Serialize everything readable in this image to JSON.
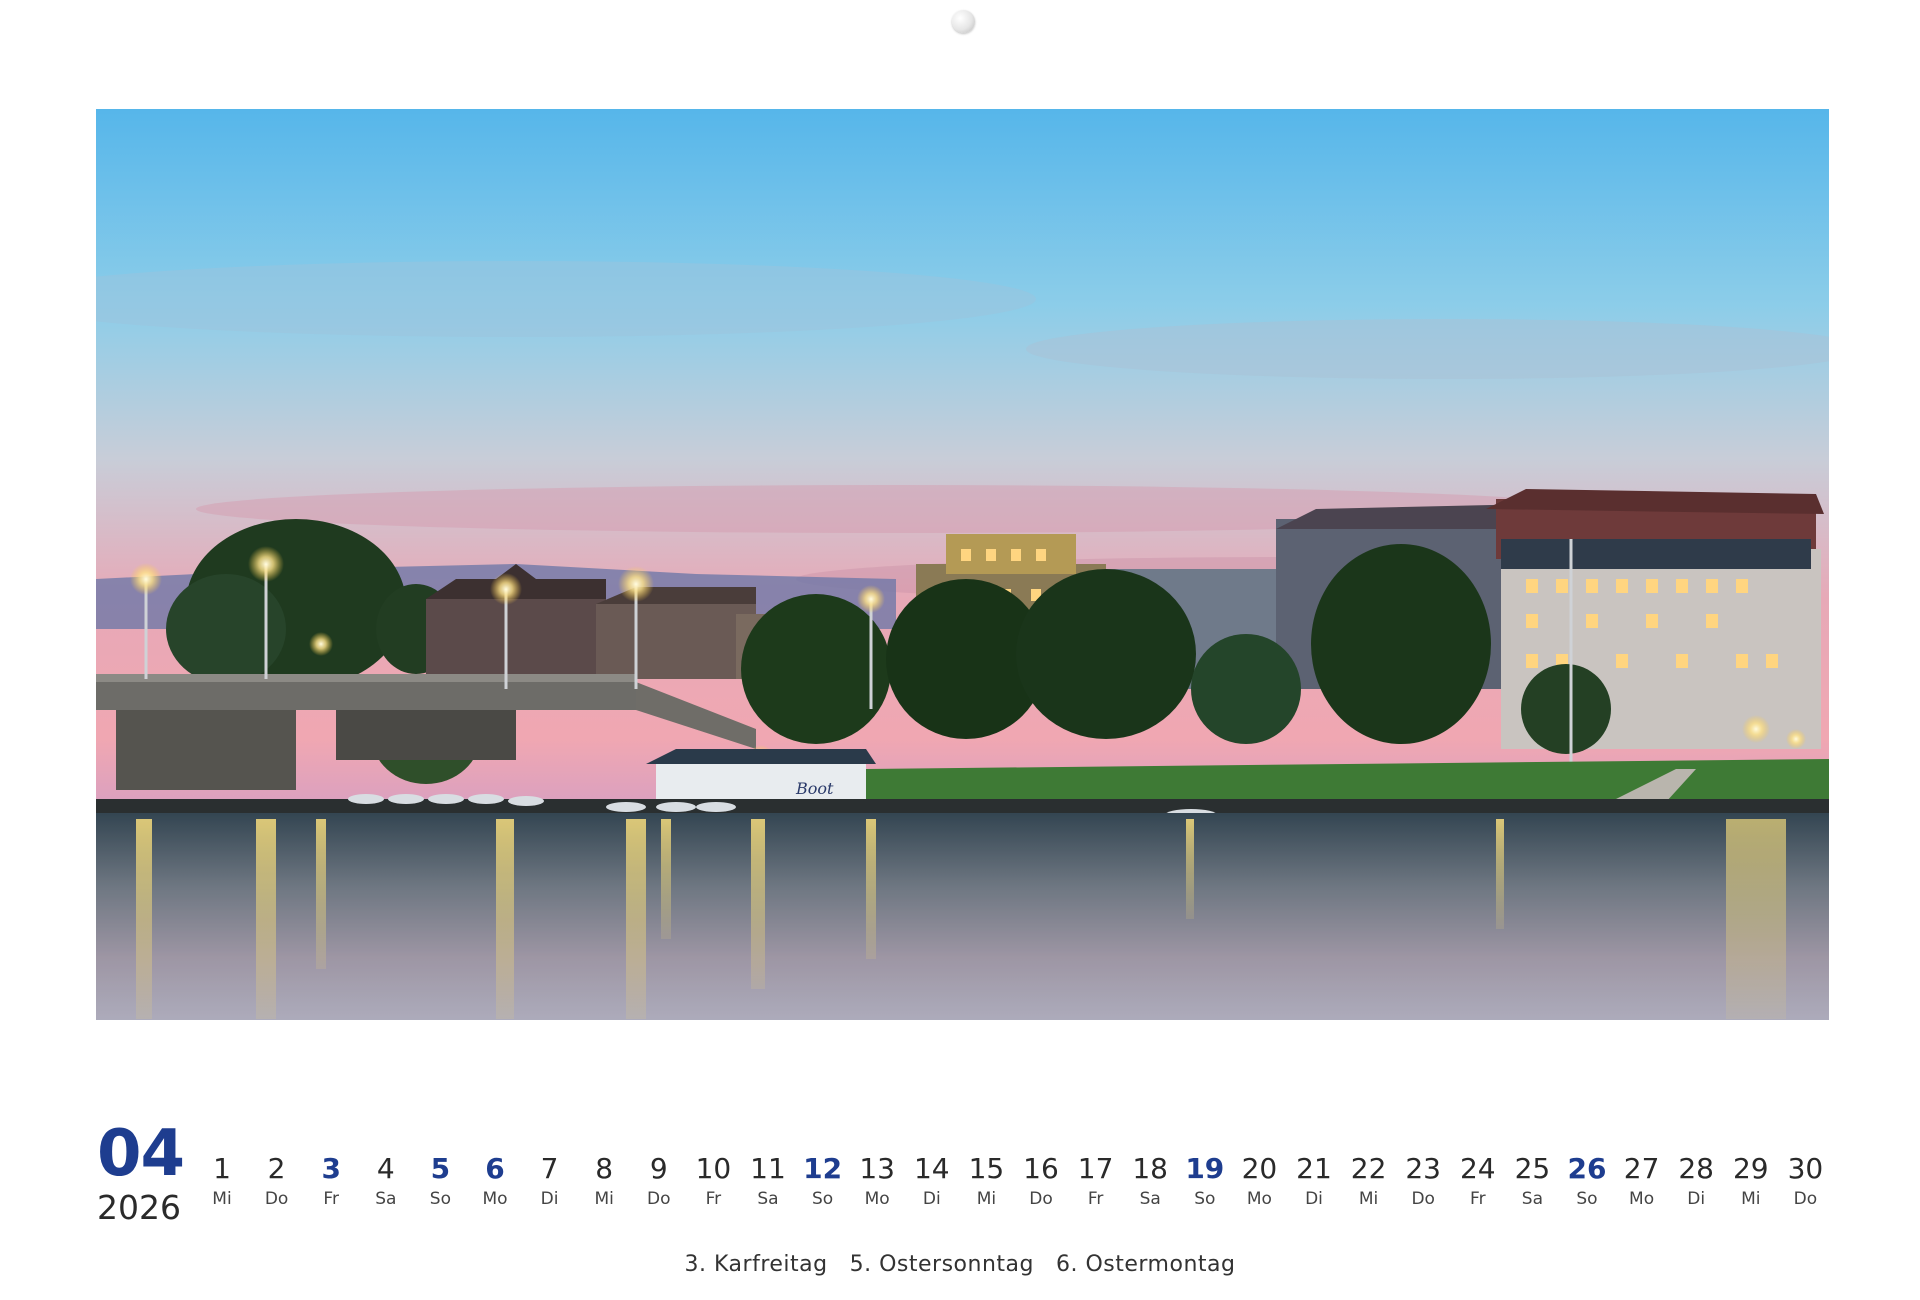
{
  "calendar": {
    "month": "04",
    "year": "2026",
    "days": [
      {
        "d": "1",
        "w": "Mi"
      },
      {
        "d": "2",
        "w": "Do"
      },
      {
        "d": "3",
        "w": "Fr",
        "highlight": true
      },
      {
        "d": "4",
        "w": "Sa"
      },
      {
        "d": "5",
        "w": "So",
        "highlight": true
      },
      {
        "d": "6",
        "w": "Mo",
        "highlight": true
      },
      {
        "d": "7",
        "w": "Di"
      },
      {
        "d": "8",
        "w": "Mi"
      },
      {
        "d": "9",
        "w": "Do"
      },
      {
        "d": "10",
        "w": "Fr"
      },
      {
        "d": "11",
        "w": "Sa"
      },
      {
        "d": "12",
        "w": "So",
        "highlight": true
      },
      {
        "d": "13",
        "w": "Mo"
      },
      {
        "d": "14",
        "w": "Di"
      },
      {
        "d": "15",
        "w": "Mi"
      },
      {
        "d": "16",
        "w": "Do"
      },
      {
        "d": "17",
        "w": "Fr"
      },
      {
        "d": "18",
        "w": "Sa"
      },
      {
        "d": "19",
        "w": "So",
        "highlight": true
      },
      {
        "d": "20",
        "w": "Mo"
      },
      {
        "d": "21",
        "w": "Di"
      },
      {
        "d": "22",
        "w": "Mi"
      },
      {
        "d": "23",
        "w": "Do"
      },
      {
        "d": "24",
        "w": "Fr"
      },
      {
        "d": "25",
        "w": "Sa"
      },
      {
        "d": "26",
        "w": "So",
        "highlight": true
      },
      {
        "d": "27",
        "w": "Mo"
      },
      {
        "d": "28",
        "w": "Di"
      },
      {
        "d": "29",
        "w": "Mi"
      },
      {
        "d": "30",
        "w": "Do"
      }
    ],
    "holidays": [
      "3. Karfreitag",
      "5. Ostersonntag",
      "6. Ostermontag"
    ]
  },
  "photo": {
    "boathouse_sign": "Boot"
  },
  "colors": {
    "accent": "#1e3d8f",
    "text": "#2a2a2a"
  }
}
